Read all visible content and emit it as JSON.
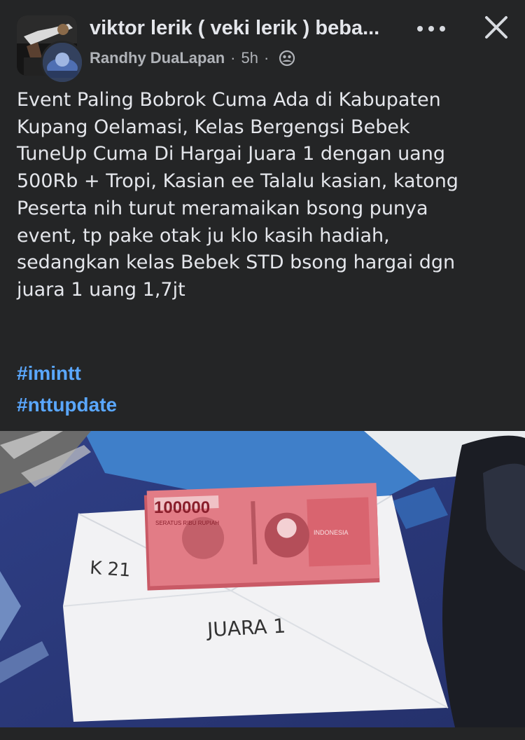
{
  "header": {
    "group_title": "viktor lerik ( veki lerik ) beba...",
    "author": "Randhy DuaLapan",
    "separator": "·",
    "time": "5h",
    "privacy_icon": "group-members-icon",
    "more_icon": "more-dots-icon",
    "close_icon": "close-icon"
  },
  "post": {
    "lines": [
      "Event Paling Bobrok Cuma Ada di Kabupaten",
      "Kupang Oelamasi, Kelas Bergengsi Bebek",
      "TuneUp Cuma Di Hargai Juara 1 dengan uang",
      "500Rb + Tropi, Kasian ee Talalu kasian, katong",
      "Peserta nih turut meramaikan bsong punya",
      "event, tp pake otak ju klo kasih hadiah,",
      "sedangkan kelas Bebek STD bsong hargai dgn",
      "juara 1 uang 1,7jt"
    ],
    "hashtags": [
      "#imintt",
      "#nttupdate"
    ]
  },
  "photo": {
    "banknote_value": "100000",
    "banknote_words": "SERATUS RIBU RUPIAH",
    "banknote_country": "INDONESIA",
    "envelope_label_1": "K 21",
    "envelope_label_2": "JUARA 1"
  },
  "colors": {
    "background": "#242526",
    "text": "#e4e6eb",
    "secondary_text": "#b0b3b8",
    "hashtag": "#5aa7ff",
    "banknote": "#e0707a"
  }
}
